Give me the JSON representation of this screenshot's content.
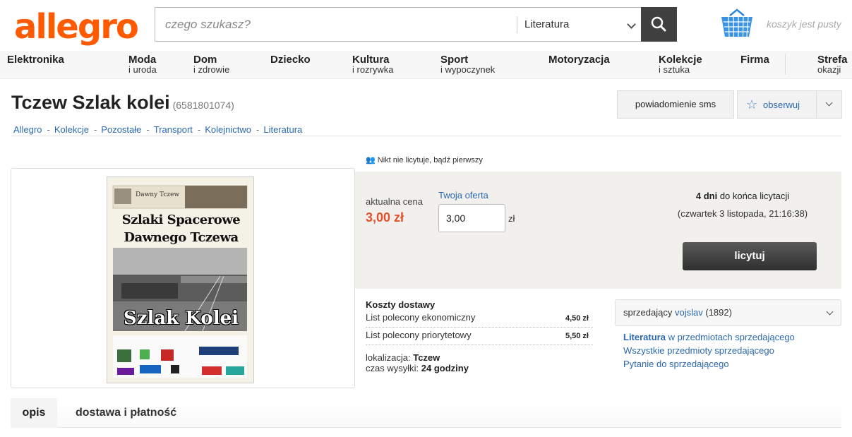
{
  "header": {
    "logo": "allegro",
    "search_placeholder": "czego szukasz?",
    "search_category": "Literatura",
    "cart_text": "koszyk jest pusty"
  },
  "nav": [
    {
      "main": "Elektronika",
      "sub": ""
    },
    {
      "main": "Moda",
      "sub": "i uroda"
    },
    {
      "main": "Dom",
      "sub": "i zdrowie"
    },
    {
      "main": "Dziecko",
      "sub": ""
    },
    {
      "main": "Kultura",
      "sub": "i rozrywka"
    },
    {
      "main": "Sport",
      "sub": "i wypoczynek"
    },
    {
      "main": "Motoryzacja",
      "sub": ""
    },
    {
      "main": "Kolekcje",
      "sub": "i sztuka"
    },
    {
      "main": "Firma",
      "sub": ""
    },
    {
      "main": "Strefa",
      "sub": "okazji"
    }
  ],
  "item": {
    "title": "Tczew Szlak kolei",
    "id": "(6581801074)",
    "sms_button": "powiadomienie sms",
    "watch_button": "obserwuj"
  },
  "breadcrumbs": [
    "Allegro",
    "Kolekcje",
    "Pozostałe",
    "Transport",
    "Kolejnictwo",
    "Literatura"
  ],
  "cover": {
    "top_label": "Dawny Tczew",
    "title_line1": "Szlaki Spacerowe",
    "title_line2": "Dawnego Tczewa",
    "main_title": "Szlak Kolei"
  },
  "bidding": {
    "no_bids": "Nikt nie licytuje, bądź pierwszy",
    "current_price_label": "aktualna cena",
    "current_price": "3,00 zł",
    "your_offer_label": "Twoja oferta",
    "offer_value": "3,00",
    "currency": "zł",
    "days_left": "4 dni",
    "days_left_suffix": " do końca licytacji",
    "end_date": "(czwartek 3 listopada, 21:16:38)",
    "bid_button": "licytuj"
  },
  "shipping": {
    "title": "Koszty dostawy",
    "options": [
      {
        "name": "List polecony ekonomiczny",
        "price": "4,50 zł"
      },
      {
        "name": "List polecony priorytetowy",
        "price": "5,50 zł"
      }
    ],
    "location_label": "lokalizacja:",
    "location_value": "Tczew",
    "dispatch_label": "czas wysyłki:",
    "dispatch_value": "24 godziny"
  },
  "seller": {
    "label": "sprzedający",
    "nick": "vojslav",
    "rating": "(1892)",
    "link1_strong": "Literatura",
    "link1_rest": " w przedmiotach sprzedającego",
    "link2": "Wszystkie przedmioty sprzedającego",
    "link3": "Pytanie do sprzedającego"
  },
  "tabs": [
    "opis",
    "dostawa i płatność"
  ],
  "colors": {
    "brand": "#ff5a00",
    "link": "#2b69b0",
    "price": "#e4502b"
  }
}
